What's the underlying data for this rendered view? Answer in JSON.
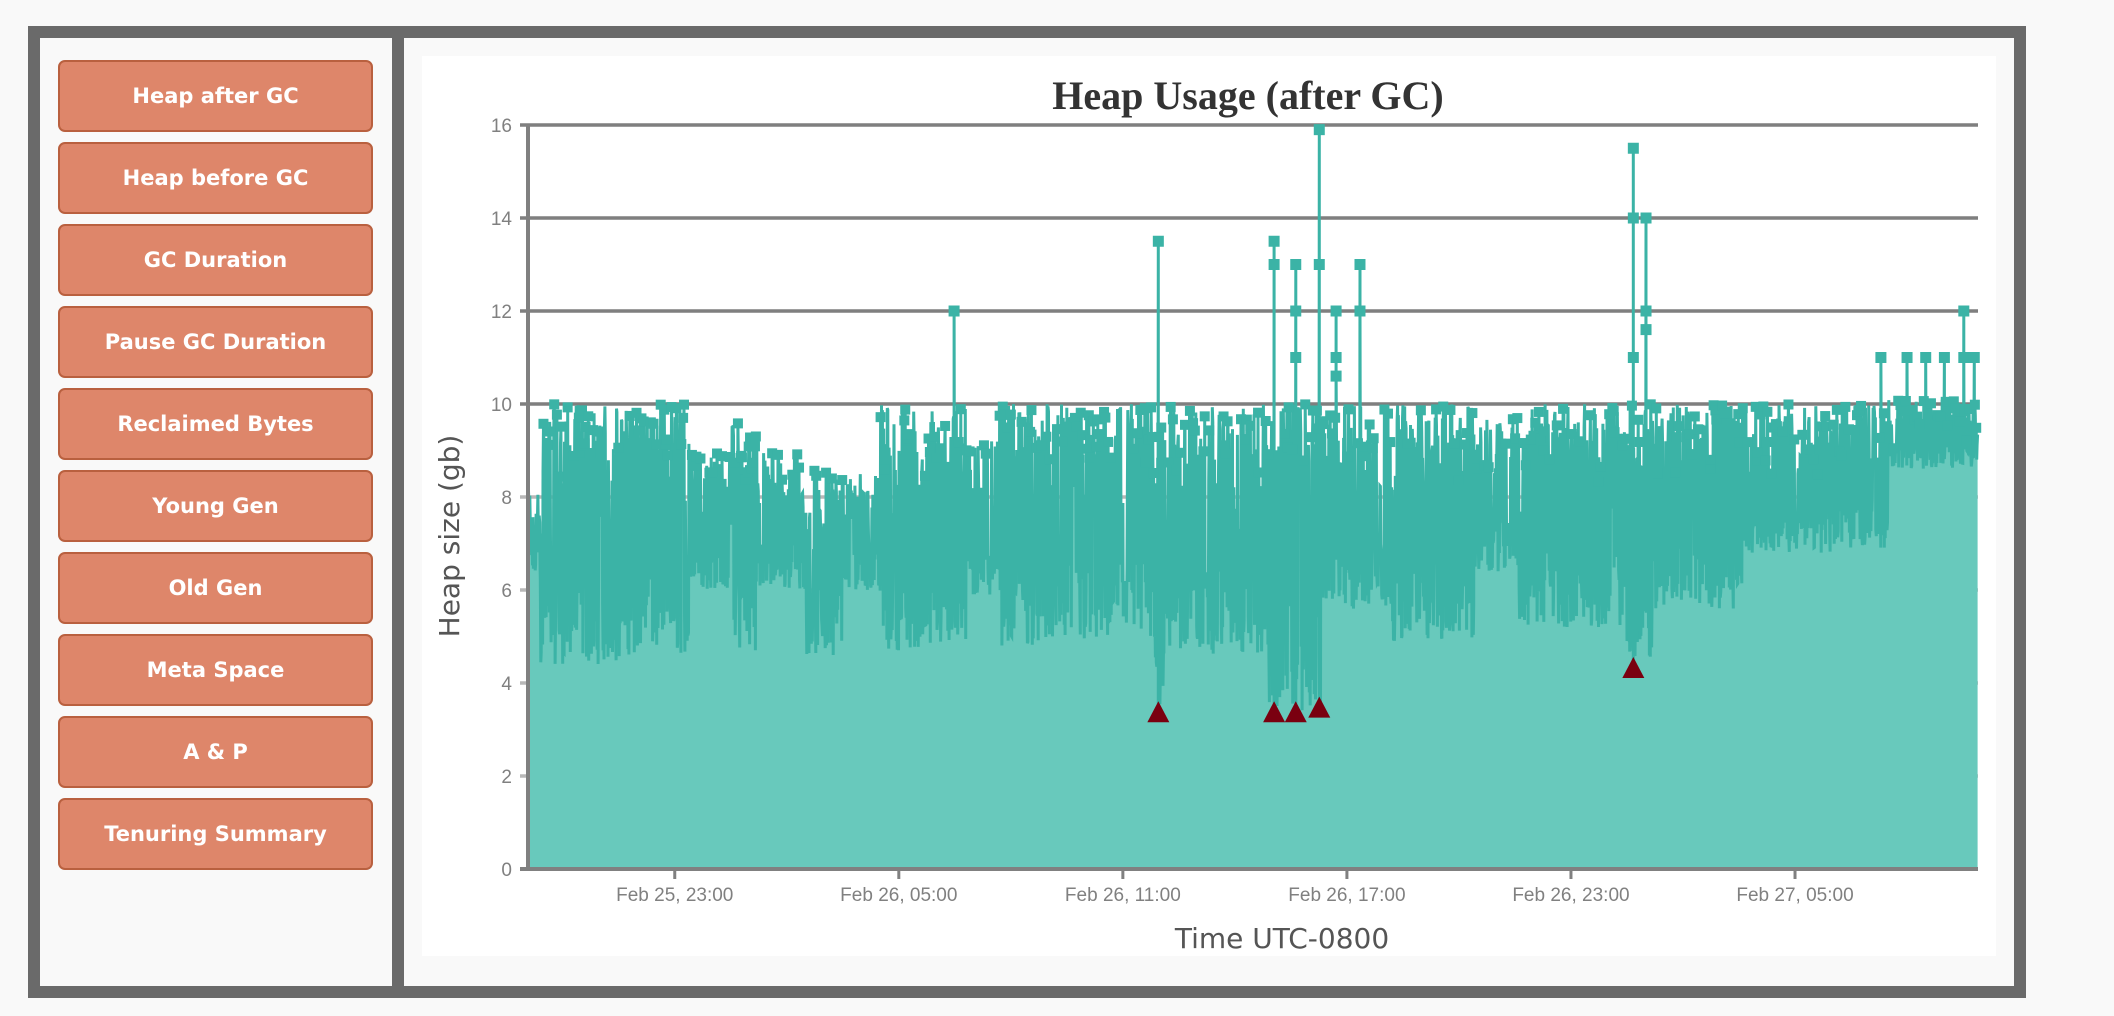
{
  "sidebar": {
    "buttons": [
      {
        "label": "Heap after GC",
        "name": "heap-after-gc-button"
      },
      {
        "label": "Heap before GC",
        "name": "heap-before-gc-button"
      },
      {
        "label": "GC Duration",
        "name": "gc-duration-button"
      },
      {
        "label": "Pause GC Duration",
        "name": "pause-gc-duration-button"
      },
      {
        "label": "Reclaimed Bytes",
        "name": "reclaimed-bytes-button"
      },
      {
        "label": "Young Gen",
        "name": "young-gen-button"
      },
      {
        "label": "Old Gen",
        "name": "old-gen-button"
      },
      {
        "label": "Meta Space",
        "name": "meta-space-button"
      },
      {
        "label": "A & P",
        "name": "a-and-p-button"
      },
      {
        "label": "Tenuring Summary",
        "name": "tenuring-summary-button"
      }
    ]
  },
  "colors": {
    "button_bg": "#de866a",
    "button_border": "#b9603f",
    "series_line": "#3bb3a6",
    "series_fill": "#68c9bc",
    "marker_full_gc": "#7a0010",
    "gridline": "#808080"
  },
  "chart_data": {
    "type": "area",
    "title": "Heap Usage (after GC)",
    "xlabel": "Time UTC-0800",
    "ylabel": "Heap size (gb)",
    "ylim": [
      0,
      16
    ],
    "yticks": [
      0,
      2,
      4,
      6,
      8,
      10,
      12,
      14,
      16
    ],
    "xlim_hours_from_feb25_23": [
      -3.93,
      34.9
    ],
    "xticks": [
      {
        "label": "Feb 25, 23:00",
        "h": 0
      },
      {
        "label": "Feb 26, 05:00",
        "h": 6
      },
      {
        "label": "Feb 26, 11:00",
        "h": 12
      },
      {
        "label": "Feb 26, 17:00",
        "h": 18
      },
      {
        "label": "Feb 26, 23:00",
        "h": 24
      },
      {
        "label": "Feb 27, 05:00",
        "h": 30
      }
    ],
    "grid": true,
    "legend": "none",
    "series": [
      {
        "name": "Heap after GC",
        "envelope_note": "dense GC samples oscillating between low and high per segment (hours relative to Feb 25 23:00)",
        "segments": [
          {
            "from": -3.93,
            "to": -3.6,
            "low": 6.2,
            "high": 8.2
          },
          {
            "from": -3.6,
            "to": -1.3,
            "low": 4.4,
            "high": 10.0
          },
          {
            "from": -1.3,
            "to": 0.4,
            "low": 4.6,
            "high": 10.0
          },
          {
            "from": 0.4,
            "to": 1.5,
            "low": 6.0,
            "high": 9.0
          },
          {
            "from": 1.5,
            "to": 2.2,
            "low": 4.7,
            "high": 9.7
          },
          {
            "from": 2.2,
            "to": 3.5,
            "low": 6.0,
            "high": 9.0
          },
          {
            "from": 3.5,
            "to": 4.5,
            "low": 4.6,
            "high": 8.6
          },
          {
            "from": 4.5,
            "to": 5.5,
            "low": 6.0,
            "high": 8.5
          },
          {
            "from": 5.5,
            "to": 7.8,
            "low": 4.7,
            "high": 10.0
          },
          {
            "from": 7.8,
            "to": 8.7,
            "low": 5.8,
            "high": 9.2
          },
          {
            "from": 8.7,
            "to": 12.8,
            "low": 4.8,
            "high": 10.0
          },
          {
            "from": 12.8,
            "to": 13.1,
            "low": 3.4,
            "high": 9.5
          },
          {
            "from": 13.1,
            "to": 15.9,
            "low": 4.6,
            "high": 10.0
          },
          {
            "from": 15.9,
            "to": 17.3,
            "low": 3.4,
            "high": 10.0
          },
          {
            "from": 17.3,
            "to": 19.2,
            "low": 5.5,
            "high": 10.0
          },
          {
            "from": 19.2,
            "to": 21.4,
            "low": 4.9,
            "high": 10.0
          },
          {
            "from": 21.4,
            "to": 22.6,
            "low": 6.4,
            "high": 9.8
          },
          {
            "from": 22.6,
            "to": 25.5,
            "low": 5.2,
            "high": 10.0
          },
          {
            "from": 25.5,
            "to": 26.2,
            "low": 4.5,
            "high": 10.0
          },
          {
            "from": 26.2,
            "to": 28.6,
            "low": 5.6,
            "high": 10.0
          },
          {
            "from": 28.6,
            "to": 31.0,
            "low": 6.8,
            "high": 10.0
          },
          {
            "from": 31.0,
            "to": 32.5,
            "low": 6.9,
            "high": 10.0
          },
          {
            "from": 32.5,
            "to": 34.9,
            "low": 8.6,
            "high": 10.1
          }
        ],
        "spikes": [
          {
            "h": 7.48,
            "values": [
              12.0
            ]
          },
          {
            "h": 12.95,
            "values": [
              13.5
            ]
          },
          {
            "h": 16.05,
            "values": [
              13.5,
              13.0
            ]
          },
          {
            "h": 16.63,
            "values": [
              13.0,
              12.0,
              11.0
            ]
          },
          {
            "h": 17.26,
            "values": [
              15.9,
              13.0
            ]
          },
          {
            "h": 17.71,
            "values": [
              12.0,
              11.0,
              10.6
            ]
          },
          {
            "h": 18.35,
            "values": [
              13.0,
              12.0
            ]
          },
          {
            "h": 25.67,
            "values": [
              15.5,
              14.0,
              11.0,
              5.0
            ]
          },
          {
            "h": 26.01,
            "values": [
              14.0,
              12.0,
              11.6
            ]
          },
          {
            "h": 32.3,
            "values": [
              11.0
            ]
          },
          {
            "h": 33.0,
            "values": [
              11.0
            ]
          },
          {
            "h": 33.5,
            "values": [
              11.0
            ]
          },
          {
            "h": 34.0,
            "values": [
              11.0
            ]
          },
          {
            "h": 34.52,
            "values": [
              12.0,
              11.0
            ]
          },
          {
            "h": 34.8,
            "values": [
              11.0
            ]
          }
        ]
      }
    ],
    "full_gc_markers": [
      {
        "h": 12.95,
        "value": 3.35
      },
      {
        "h": 16.05,
        "value": 3.35
      },
      {
        "h": 16.63,
        "value": 3.35
      },
      {
        "h": 17.26,
        "value": 3.45
      },
      {
        "h": 25.67,
        "value": 4.3
      }
    ]
  }
}
